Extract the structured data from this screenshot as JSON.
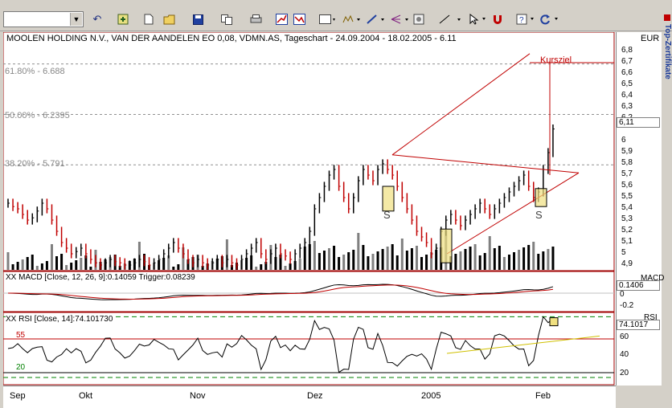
{
  "toolbar": {
    "symbol_value": "",
    "icons": [
      "back-icon",
      "refresh-icon",
      "new-doc-icon",
      "open-folder-icon",
      "save-icon",
      "copy-icon",
      "print-icon",
      "chart-prev-icon",
      "chart-next-icon",
      "window-icon",
      "indicator-icon",
      "trend-icon",
      "fork-icon",
      "settings-icon",
      "line-tool-icon",
      "cursor-icon",
      "magnet-icon",
      "help-icon",
      "reload-icon"
    ]
  },
  "side_tab": "Top-Zertifikate",
  "chart": {
    "title": "MOOLEN HOLDING N.V., VAN DER AANDELEN EO 0,08, VDMN.AS, Tageschart - 24.09.2004 - 18.02.2005 - 6.11",
    "currency": "EUR",
    "fib_levels": [
      {
        "label": "61.80% - 6.688",
        "value": 6.688
      },
      {
        "label": "50.00% - 6.2395",
        "value": 6.2395
      },
      {
        "label": "38.20% - 5.791",
        "value": 5.791
      }
    ],
    "kursziel_label": "Kursziel",
    "pattern_labels": [
      "S",
      "S"
    ],
    "price_ticks": [
      "6,8",
      "6,7",
      "6,6",
      "6,5",
      "6,4",
      "6,3",
      "6,2",
      "6",
      "5,9",
      "5,8",
      "5,7",
      "5,6",
      "5,5",
      "5,4",
      "5,3",
      "5,2",
      "5,1",
      "5",
      "4,9"
    ],
    "last_price": "6,11"
  },
  "macd": {
    "label": "XX MACD [Close, 12, 26, 9]:0.14059 Trigger:0.08239",
    "axis_title": "MACD",
    "axis_ticks": [
      "0.1406",
      "0",
      "-0.2"
    ]
  },
  "rsi": {
    "label": "XX RSI [Close, 14]:74.101730",
    "axis_title": "RSI",
    "axis_ticks": [
      "74.1017",
      "60",
      "40",
      "20"
    ],
    "level_labels": [
      "55",
      "20"
    ]
  },
  "time_axis": [
    "Sep",
    "Okt",
    "Nov",
    "Dez",
    "2005",
    "Feb"
  ],
  "chart_data": {
    "type": "line",
    "title": "MOOLEN HOLDING N.V., VAN DER AANDELEN EO 0,08, VDMN.AS, Tageschart - 24.09.2004 - 18.02.2005 - 6.11",
    "ylabel": "EUR",
    "ylim": [
      4.9,
      6.8
    ],
    "series": [
      {
        "values": [
          5.45,
          5.42,
          5.4,
          5.35,
          5.3,
          5.32,
          5.38,
          5.45,
          5.4,
          5.3,
          5.2,
          5.1,
          5.05,
          5.0,
          5.02,
          5.05,
          5.0,
          4.95,
          4.92,
          4.9,
          4.92,
          4.95,
          4.93,
          4.92,
          4.9,
          4.9,
          4.92,
          4.95,
          4.93,
          4.9,
          4.92,
          4.95,
          5.0,
          5.05,
          5.1,
          5.05,
          5.0,
          4.95,
          4.92,
          4.95,
          4.92,
          4.9,
          4.92,
          4.95,
          4.92,
          4.95,
          4.92,
          4.9,
          4.95,
          5.0,
          5.05,
          5.1,
          5.0,
          4.95,
          5.0,
          5.05,
          5.0,
          4.98,
          4.95,
          5.0,
          5.05,
          5.1,
          5.2,
          5.4,
          5.5,
          5.6,
          5.7,
          5.75,
          5.6,
          5.5,
          5.4,
          5.5,
          5.65,
          5.75,
          5.7,
          5.65,
          5.75,
          5.8,
          5.75,
          5.7,
          5.6,
          5.5,
          5.4,
          5.3,
          5.2,
          5.15,
          5.1,
          5.0,
          5.05,
          5.2,
          5.3,
          5.35,
          5.3,
          5.25,
          5.3,
          5.35,
          5.4,
          5.45,
          5.4,
          5.35,
          5.4,
          5.45,
          5.5,
          5.55,
          5.6,
          5.65,
          5.7,
          5.6,
          5.5,
          5.55,
          5.75,
          5.9,
          6.11
        ]
      }
    ]
  }
}
